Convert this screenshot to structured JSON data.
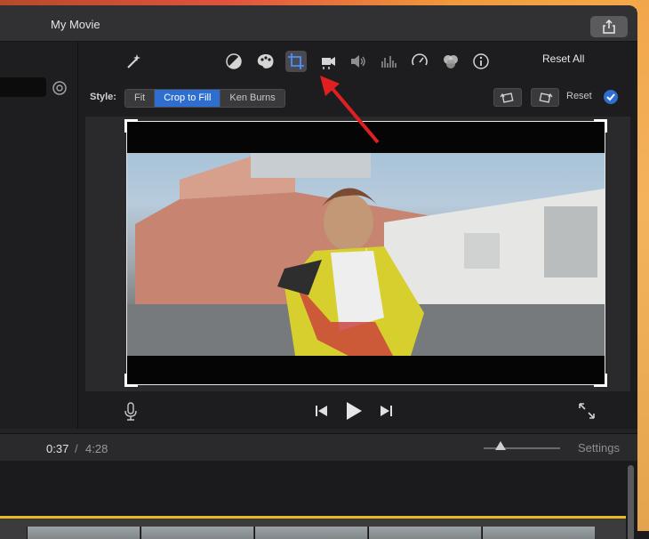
{
  "window": {
    "title": "My Movie"
  },
  "toolbar": {
    "reset_all_label": "Reset All",
    "tools": [
      {
        "name": "magic-wand-icon"
      },
      {
        "name": "color-balance-icon"
      },
      {
        "name": "color-correction-icon"
      },
      {
        "name": "crop-icon",
        "selected": true
      },
      {
        "name": "stabilization-icon"
      },
      {
        "name": "volume-icon"
      },
      {
        "name": "equalizer-icon"
      },
      {
        "name": "speed-icon"
      },
      {
        "name": "filters-icon"
      },
      {
        "name": "info-icon"
      }
    ]
  },
  "crop": {
    "style_label": "Style:",
    "options": [
      "Fit",
      "Crop to Fill",
      "Ken Burns"
    ],
    "selected": "Crop to Fill",
    "reset_label": "Reset"
  },
  "playback": {
    "current_time": "0:37",
    "separator": "/",
    "total_time": "4:28"
  },
  "timeline": {
    "settings_label": "Settings"
  },
  "colors": {
    "accent": "#2f6ed1",
    "arrow": "#e02020",
    "timeline_highlight": "#e8b928"
  }
}
